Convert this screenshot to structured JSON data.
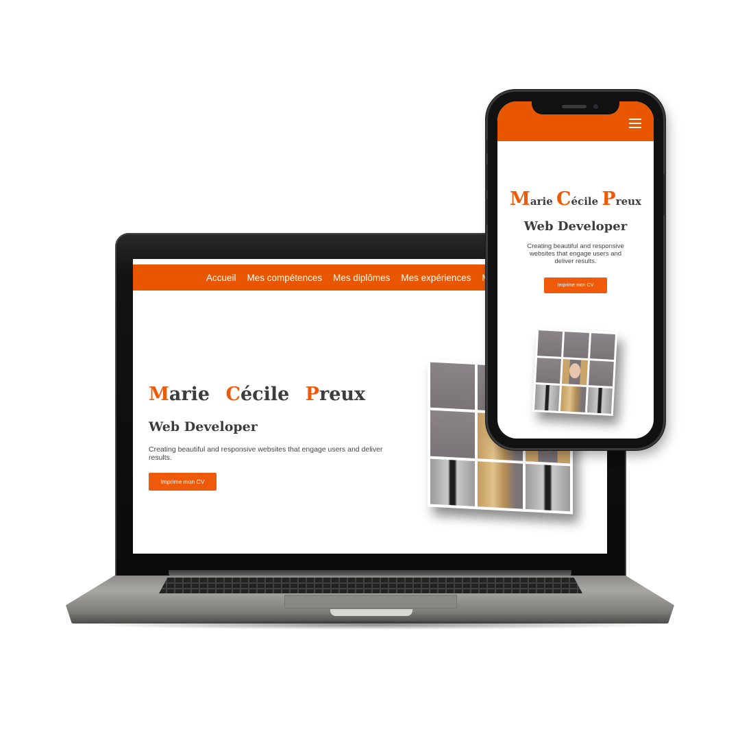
{
  "laptop": {
    "nav": {
      "items": [
        "Accueil",
        "Mes compétences",
        "Mes diplômes",
        "Mes expériences",
        "M"
      ]
    },
    "hero": {
      "name": [
        {
          "initial": "M",
          "rest": "arie"
        },
        {
          "initial": "C",
          "rest": "écile"
        },
        {
          "initial": "P",
          "rest": "reux"
        }
      ],
      "role": "Web Developer",
      "description": "Creating beautiful and responsive websites that engage users and deliver results.",
      "button_label": "Imprime mon CV"
    }
  },
  "phone": {
    "hero": {
      "name": [
        {
          "initial": "M",
          "rest": "arie"
        },
        {
          "initial": "C",
          "rest": "écile"
        },
        {
          "initial": "P",
          "rest": "reux"
        }
      ],
      "role": "Web Developer",
      "description": "Creating beautiful and responsive websites that engage users and deliver results.",
      "button_label": "Imprime mon CV"
    },
    "menu_icon": "hamburger-menu-icon"
  },
  "colors": {
    "accent": "#e85600",
    "accent_text": "#ee5a0a",
    "heading": "#3c3c3c"
  }
}
